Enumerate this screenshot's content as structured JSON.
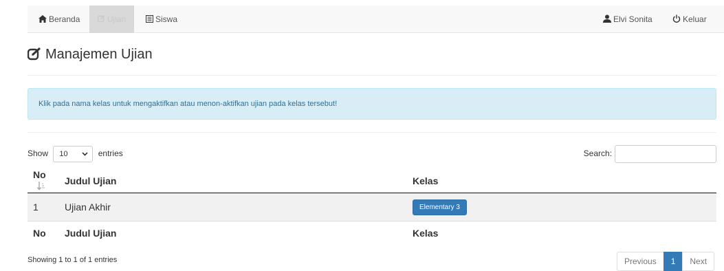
{
  "nav": {
    "items": [
      {
        "label": "Beranda",
        "icon": "home-icon"
      },
      {
        "label": "Ujian",
        "icon": "edit-icon",
        "active": true
      },
      {
        "label": "Siswa",
        "icon": "list-icon"
      }
    ],
    "user": {
      "label": "Elvi Sonita",
      "icon": "user-icon"
    },
    "logout": {
      "label": "Keluar",
      "icon": "power-icon"
    }
  },
  "page": {
    "title": "Manajemen Ujian",
    "icon": "edit-icon"
  },
  "alert": {
    "text": "Klik pada nama kelas untuk mengaktifkan atau menon-aktifkan ujian pada kelas tersebut!"
  },
  "table_controls": {
    "show_label": "Show",
    "entries_label": "entries",
    "page_length": "10",
    "search_label": "Search:",
    "search_value": ""
  },
  "table": {
    "columns": [
      "No",
      "Judul Ujian",
      "Kelas"
    ],
    "rows": [
      {
        "no": "1",
        "judul": "Ujian Akhir",
        "kelas": "Elementary 3"
      }
    ]
  },
  "footer": {
    "info": "Showing 1 to 1 of 1 entries",
    "pagination": {
      "previous": "Previous",
      "current": "1",
      "next": "Next"
    }
  },
  "colors": {
    "primary": "#337ab7",
    "alert_bg": "#d9edf7",
    "alert_text": "#31708f"
  }
}
